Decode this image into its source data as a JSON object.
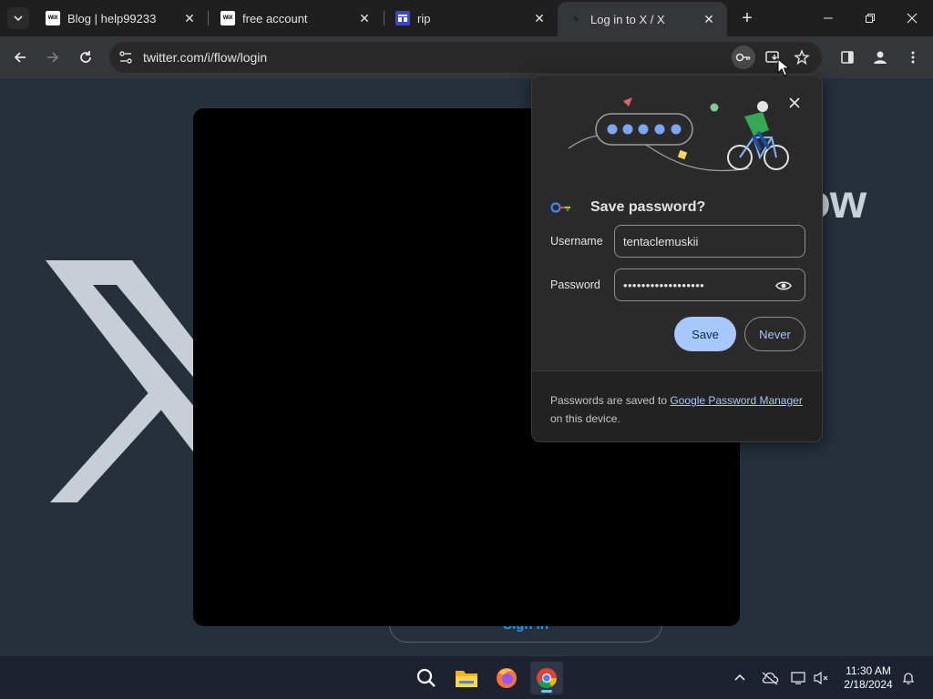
{
  "tabs": [
    {
      "title": "Blog | help99233",
      "favicon": "wix-icon",
      "favicon_text": "WiX"
    },
    {
      "title": "free account",
      "favicon": "wix-icon",
      "favicon_text": "WiX"
    },
    {
      "title": "rip",
      "favicon": "rip-site-icon"
    },
    {
      "title": "Log in to X / X",
      "favicon": "x-icon",
      "favicon_text": "𝕏",
      "active": true
    }
  ],
  "new_tab_label": "+",
  "address_bar": {
    "url": "twitter.com/i/flow/login"
  },
  "page": {
    "background_text": "ow",
    "signin_label": "Sign in"
  },
  "password_popup": {
    "title": "Save password?",
    "username_label": "Username",
    "username_value": "tentaclemuskii",
    "password_label": "Password",
    "password_value": "••••••••••••••••••",
    "save_label": "Save",
    "never_label": "Never",
    "footer_prefix": "Passwords are saved to ",
    "footer_link": "Google Password Manager",
    "footer_suffix": " on this device."
  },
  "taskbar": {
    "time": "11:30 AM",
    "date": "2/18/2024"
  },
  "colors": {
    "accent": "#a8c7fa",
    "page_bg": "#25303b",
    "popup_bg": "#2a2a2a",
    "twitter_blue": "#1d9bf0"
  }
}
